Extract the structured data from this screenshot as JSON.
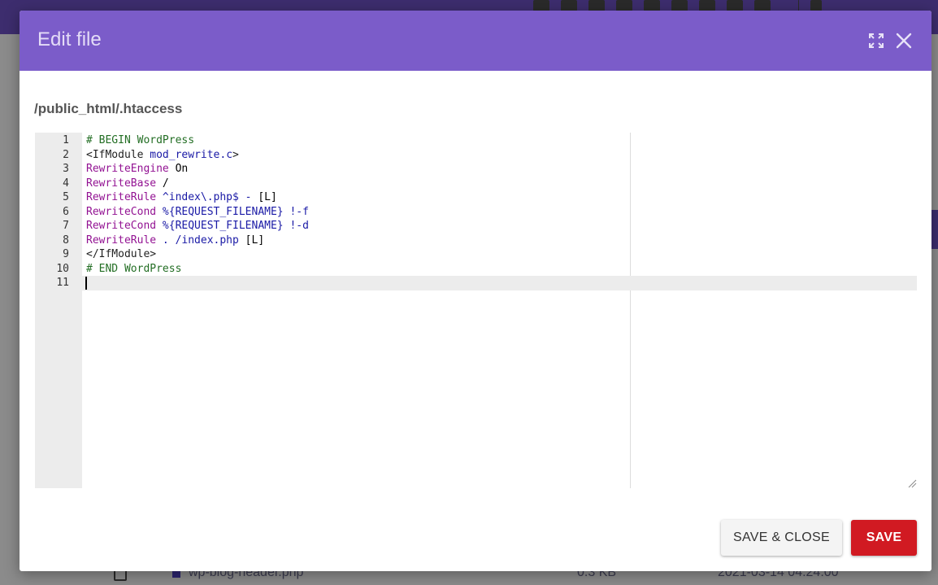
{
  "background": {
    "row": {
      "filename": "wp-blog-header.php",
      "size": "0.3 KB",
      "date": "2021-03-14 04:24:00"
    }
  },
  "modal": {
    "title": "Edit file",
    "expand_icon": "expand-icon",
    "close_icon": "close-icon",
    "file_path": "/public_html/.htaccess"
  },
  "editor": {
    "active_line": 11,
    "lines": [
      {
        "n": "1",
        "tokens": [
          {
            "t": "# BEGIN WordPress",
            "c": "comment"
          }
        ]
      },
      {
        "n": "2",
        "tokens": [
          {
            "t": "<IfModule ",
            "c": "tag"
          },
          {
            "t": "mod_rewrite.c",
            "c": "string"
          },
          {
            "t": ">",
            "c": "tag"
          }
        ]
      },
      {
        "n": "3",
        "tokens": [
          {
            "t": "RewriteEngine",
            "c": "keyword"
          },
          {
            "t": " On",
            "c": "plain"
          }
        ]
      },
      {
        "n": "4",
        "tokens": [
          {
            "t": "RewriteBase",
            "c": "keyword"
          },
          {
            "t": " /",
            "c": "plain"
          }
        ]
      },
      {
        "n": "5",
        "tokens": [
          {
            "t": "RewriteRule",
            "c": "keyword"
          },
          {
            "t": " ^index\\.php$ - ",
            "c": "string"
          },
          {
            "t": "[L]",
            "c": "plain"
          }
        ]
      },
      {
        "n": "6",
        "tokens": [
          {
            "t": "RewriteCond",
            "c": "keyword"
          },
          {
            "t": " %{REQUEST_FILENAME} !-f",
            "c": "string"
          }
        ]
      },
      {
        "n": "7",
        "tokens": [
          {
            "t": "RewriteCond",
            "c": "keyword"
          },
          {
            "t": " %{REQUEST_FILENAME} !-d",
            "c": "string"
          }
        ]
      },
      {
        "n": "8",
        "tokens": [
          {
            "t": "RewriteRule",
            "c": "keyword"
          },
          {
            "t": " . /index.php ",
            "c": "string"
          },
          {
            "t": "[L]",
            "c": "plain"
          }
        ]
      },
      {
        "n": "9",
        "tokens": [
          {
            "t": "</IfModule>",
            "c": "tag"
          }
        ]
      },
      {
        "n": "10",
        "tokens": [
          {
            "t": "# END WordPress",
            "c": "comment"
          }
        ]
      },
      {
        "n": "11",
        "tokens": []
      }
    ]
  },
  "footer": {
    "save_close_label": "SAVE & CLOSE",
    "save_label": "SAVE"
  },
  "colors": {
    "header": "#7b5cc9",
    "save_button": "#d11a22",
    "comment": "#236e24",
    "keyword": "#931393",
    "string": "#1a1aa6"
  }
}
